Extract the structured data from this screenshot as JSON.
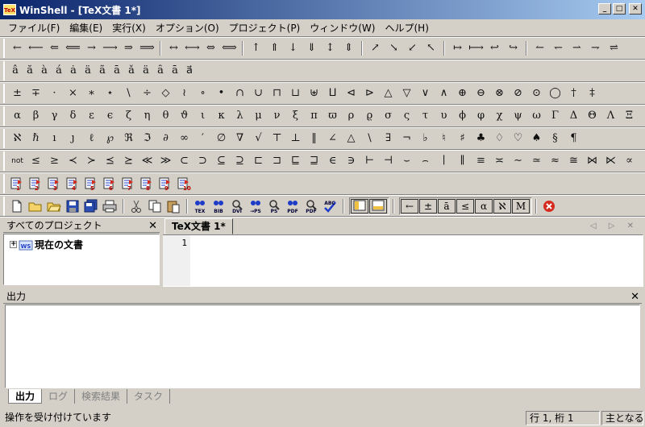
{
  "title": "WinShell - [TeX文書 1*]",
  "title_logo": "TeX",
  "window_buttons": [
    "_",
    "□",
    "✕"
  ],
  "menu": [
    "ファイル(F)",
    "編集(E)",
    "実行(X)",
    "オプション(O)",
    "プロジェクト(P)",
    "ウィンドウ(W)",
    "ヘルプ(H)"
  ],
  "toolbar_arrows": [
    "←",
    "⟵",
    "⇐",
    "⟸",
    "→",
    "⟶",
    "⇒",
    "⟹",
    "|",
    "↔",
    "⟷",
    "⇔",
    "⟺",
    "|",
    "↑",
    "⇑",
    "↓",
    "⇓",
    "↕",
    "⇕",
    "|",
    "↗",
    "↘",
    "↙",
    "↖",
    "|",
    "↦",
    "⟼",
    "↩",
    "↪",
    "|",
    "↼",
    "↽",
    "⇀",
    "⇁",
    "⇌"
  ],
  "toolbar_accents": [
    "â",
    "ă",
    "à",
    "á",
    "ȧ",
    "ä",
    "ã",
    "ā",
    "ǎ",
    "ä",
    "ȃ",
    "ā",
    "a⃗"
  ],
  "toolbar_binary": [
    "±",
    "∓",
    "·",
    "×",
    "∗",
    "⋆",
    "\\",
    "÷",
    "◇",
    "≀",
    "∘",
    "•",
    "∩",
    "∪",
    "⊓",
    "⊔",
    "⊎",
    "⨿",
    "⊲",
    "⊳",
    "△",
    "▽",
    "∨",
    "∧",
    "⊕",
    "⊖",
    "⊗",
    "⊘",
    "⊙",
    "◯",
    "†",
    "‡"
  ],
  "toolbar_greek": [
    "α",
    "β",
    "γ",
    "δ",
    "ε",
    "ϵ",
    "ζ",
    "η",
    "θ",
    "ϑ",
    "ι",
    "κ",
    "λ",
    "μ",
    "ν",
    "ξ",
    "π",
    "ϖ",
    "ρ",
    "ϱ",
    "σ",
    "ς",
    "τ",
    "υ",
    "ϕ",
    "φ",
    "χ",
    "ψ",
    "ω",
    "Γ",
    "Δ",
    "Θ",
    "Λ",
    "Ξ"
  ],
  "toolbar_misc": [
    "ℵ",
    "ℏ",
    "ı",
    "ȷ",
    "ℓ",
    "℘",
    "ℜ",
    "ℑ",
    "∂",
    "∞",
    "′",
    "∅",
    "∇",
    "√",
    "⊤",
    "⊥",
    "‖",
    "∠",
    "△",
    "\\",
    "∃",
    "¬",
    "♭",
    "♮",
    "♯",
    "♣",
    "♢",
    "♡",
    "♠",
    "§",
    "¶"
  ],
  "toolbar_relations": [
    "not",
    "≤",
    "≥",
    "≺",
    "≻",
    "⪯",
    "⪰",
    "≪",
    "≫",
    "⊂",
    "⊃",
    "⊆",
    "⊇",
    "⊏",
    "⊐",
    "⊑",
    "⊒",
    "∈",
    "∋",
    "⊢",
    "⊣",
    "⌣",
    "⌢",
    "∣",
    "∥",
    "≡",
    "≍",
    "∼",
    "≃",
    "≈",
    "≅",
    "⋈",
    "⋉",
    "∝"
  ],
  "toolbar_runs": [
    "1",
    "2",
    "3",
    "4",
    "5",
    "6",
    "7",
    "8",
    "9",
    "10"
  ],
  "toolbar_std_labels": [
    "TEX",
    "BIB",
    "DVI",
    "→PS",
    "PS",
    "PDF",
    "PDF",
    "ABC"
  ],
  "toolbar_framed": [
    "←",
    "±",
    "ā",
    "≤",
    "α",
    "ℵ",
    "M"
  ],
  "project_panel": {
    "title": "すべてのプロジェクト",
    "close": "✕",
    "tree_label": "現在の文書",
    "tree_icon_text": "WS"
  },
  "editor": {
    "tab_label": "TeX文書 1*",
    "line_number": "1",
    "nav": "◁ ▷ ✕"
  },
  "output_panel": {
    "title": "出力",
    "close": "✕"
  },
  "output_tabs": [
    "出力",
    "ログ",
    "検索結果",
    "タスク"
  ],
  "status": {
    "message": "操作を受け付けています",
    "position": "行 1, 桁 1",
    "mode": "主となる"
  }
}
